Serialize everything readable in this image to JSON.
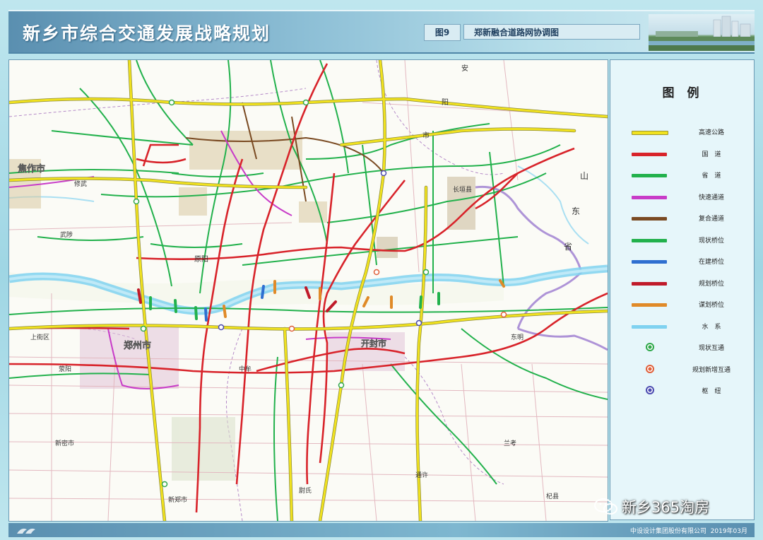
{
  "header": {
    "title": "新乡市综合交通发展战略规划",
    "figure_number": "图9",
    "figure_title": "郑新融合道路网协调图"
  },
  "map": {
    "places": {
      "jiaozuo": "焦作市",
      "zhengzhou": "郑州市",
      "kaifeng": "开封市",
      "xiuwu": "修武",
      "wuzhi": "武陟",
      "yangyang": "阳",
      "yuanyang": "原阳",
      "changyuan": "长垣县",
      "zhongmou": "中牟",
      "shandong_1": "山",
      "shandong_2": "东",
      "shandong_3": "省",
      "xinmi": "新密市",
      "xinzheng": "新郑市",
      "weishi": "尉氏",
      "lankao": "兰考",
      "qixian": "杞县",
      "tongxu": "通许",
      "yingyang": "荥阳",
      "shangjie": "上街区",
      "an": "安",
      "shi": "市",
      "dongming": "东明"
    }
  },
  "legend": {
    "title": "图 例",
    "items": [
      {
        "label": "高速公路",
        "color": "#f1e21e",
        "kind": "line"
      },
      {
        "label": "国　道",
        "color": "#d8232a",
        "kind": "line"
      },
      {
        "label": "省　道",
        "color": "#22b14c",
        "kind": "line"
      },
      {
        "label": "快速通道",
        "color": "#c83cc8",
        "kind": "line"
      },
      {
        "label": "复合通道",
        "color": "#7a4a22",
        "kind": "line"
      },
      {
        "label": "现状桥位",
        "color": "#22b14c",
        "kind": "line"
      },
      {
        "label": "在建桥位",
        "color": "#2f6fd0",
        "kind": "line"
      },
      {
        "label": "规划桥位",
        "color": "#c01a2a",
        "kind": "line"
      },
      {
        "label": "谋划桥位",
        "color": "#e08a28",
        "kind": "line"
      },
      {
        "label": "水　系",
        "color": "#7fd2f0",
        "kind": "line"
      },
      {
        "label": "现状互通",
        "color": "#2fa84a",
        "kind": "dot"
      },
      {
        "label": "规划新增互通",
        "color": "#e0603a",
        "kind": "dot"
      },
      {
        "label": "枢　纽",
        "color": "#4a4ab0",
        "kind": "dot"
      }
    ]
  },
  "footer": {
    "company": "中设设计集团股份有限公司",
    "date": "2019年03月"
  },
  "watermark": {
    "text": "新乡365淘房"
  }
}
